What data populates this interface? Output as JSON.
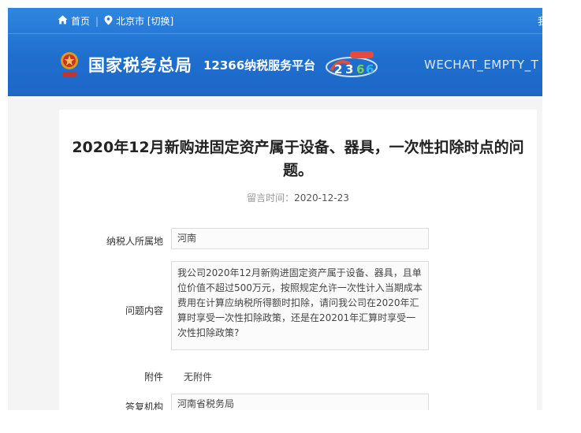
{
  "topbar": {
    "home_label": "首页",
    "location_label": "北京市 [切换]",
    "right_cut": "我"
  },
  "header": {
    "agency_name": "国家税务总局",
    "platform_name": "12366纳税服务平台",
    "wechat_text": "WECHAT_EMPTY_T"
  },
  "question": {
    "title": "2020年12月新购进固定资产属于设备、器具，一次性扣除时点的问题。",
    "time_label": "留言时间：",
    "time_value": "2020-12-23",
    "taxpayer_location_label": "纳税人所属地",
    "taxpayer_location_value": "河南",
    "content_label": "问题内容",
    "content_value": "我公司2020年12月新购进固定资产属于设备、器具，且单位价值不超过500万元，按照规定允许一次性计入当期成本费用在计算应纳税所得额时扣除，请问我公司在2020年汇算时享受一次性扣除政策，还是在20201年汇算时享受一次性扣除政策?",
    "attachment_label": "附件",
    "attachment_value": "无附件",
    "reply_agency_label": "答复机构",
    "reply_agency_value": "河南省税务局"
  },
  "colors": {
    "header_blue": "#1f6fcf",
    "page_bg": "#f4f4f4"
  },
  "icons": [
    "home-icon",
    "location-pin-icon",
    "tax-emblem-icon",
    "12366-logo-icon"
  ]
}
